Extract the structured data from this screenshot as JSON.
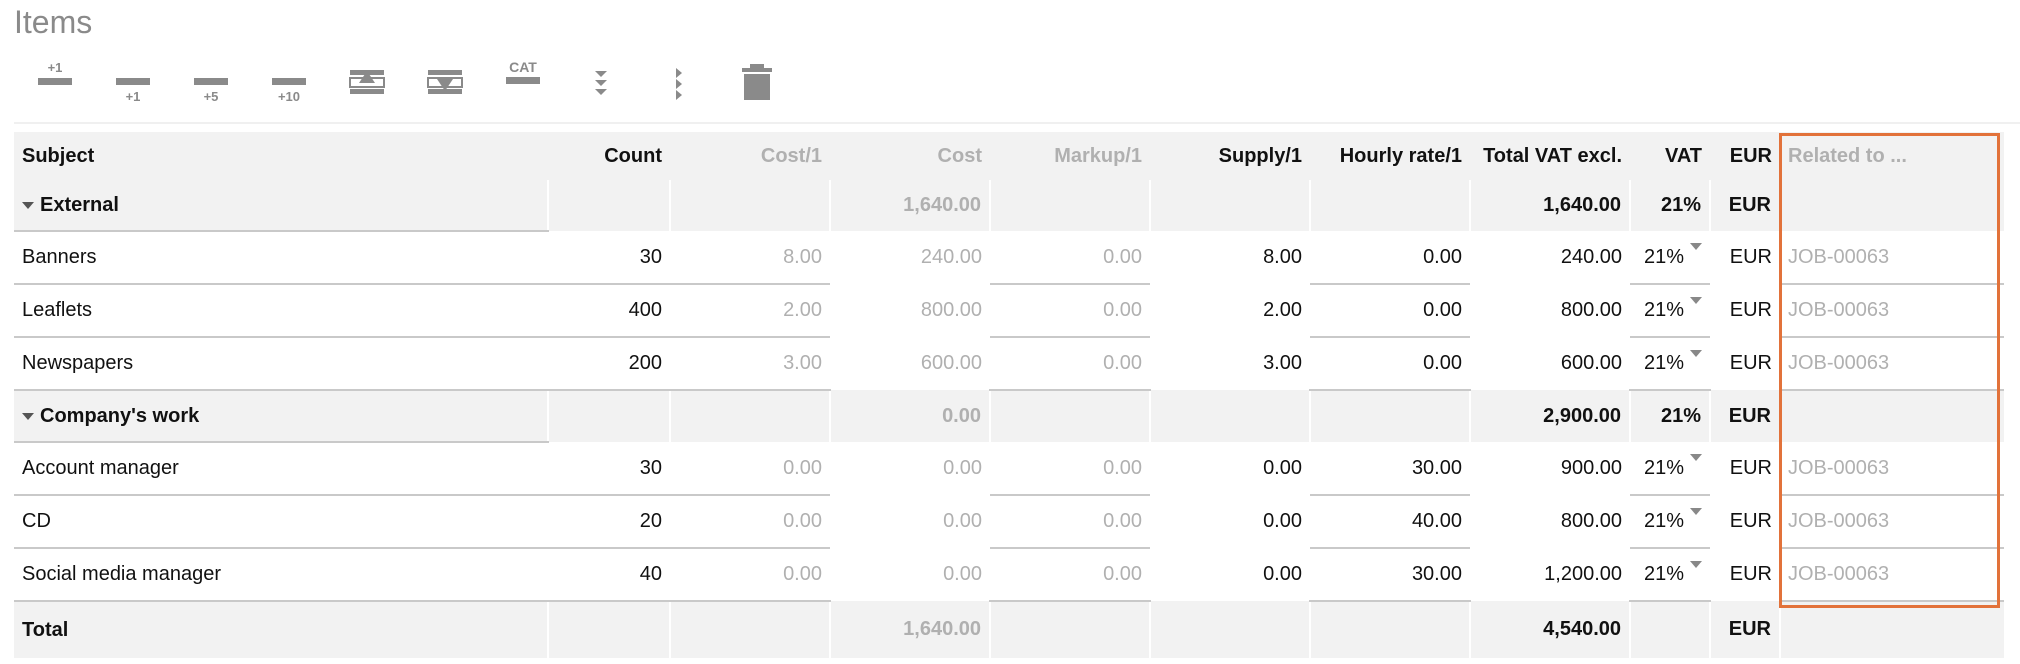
{
  "page": {
    "title": "Items"
  },
  "toolbar": {
    "add_one": "+1",
    "add_row_1": "+1",
    "add_row_5": "+5",
    "add_row_10": "+10",
    "cat": "CAT"
  },
  "table": {
    "headers": {
      "subject": "Subject",
      "count": "Count",
      "cost_per": "Cost/1",
      "cost": "Cost",
      "markup_per": "Markup/1",
      "supply_per": "Supply/1",
      "hourly_rate": "Hourly rate/1",
      "total_vat_excl": "Total VAT excl.",
      "vat": "VAT",
      "currency": "EUR",
      "related_to": "Related to ..."
    },
    "groups": [
      {
        "name": "External",
        "cost": "1,640.00",
        "total": "1,640.00",
        "vat": "21%",
        "currency": "EUR",
        "items": [
          {
            "subject": "Banners",
            "count": "30",
            "cost_per": "8.00",
            "cost": "240.00",
            "markup": "0.00",
            "supply": "8.00",
            "hourly": "0.00",
            "total": "240.00",
            "vat": "21%",
            "currency": "EUR",
            "related": "JOB-00063"
          },
          {
            "subject": "Leaflets",
            "count": "400",
            "cost_per": "2.00",
            "cost": "800.00",
            "markup": "0.00",
            "supply": "2.00",
            "hourly": "0.00",
            "total": "800.00",
            "vat": "21%",
            "currency": "EUR",
            "related": "JOB-00063"
          },
          {
            "subject": "Newspapers",
            "count": "200",
            "cost_per": "3.00",
            "cost": "600.00",
            "markup": "0.00",
            "supply": "3.00",
            "hourly": "0.00",
            "total": "600.00",
            "vat": "21%",
            "currency": "EUR",
            "related": "JOB-00063"
          }
        ]
      },
      {
        "name": "Company's work",
        "cost": "0.00",
        "total": "2,900.00",
        "vat": "21%",
        "currency": "EUR",
        "items": [
          {
            "subject": "Account manager",
            "count": "30",
            "cost_per": "0.00",
            "cost": "0.00",
            "markup": "0.00",
            "supply": "0.00",
            "hourly": "30.00",
            "total": "900.00",
            "vat": "21%",
            "currency": "EUR",
            "related": "JOB-00063"
          },
          {
            "subject": "CD",
            "count": "20",
            "cost_per": "0.00",
            "cost": "0.00",
            "markup": "0.00",
            "supply": "0.00",
            "hourly": "40.00",
            "total": "800.00",
            "vat": "21%",
            "currency": "EUR",
            "related": "JOB-00063"
          },
          {
            "subject": "Social media manager",
            "count": "40",
            "cost_per": "0.00",
            "cost": "0.00",
            "markup": "0.00",
            "supply": "0.00",
            "hourly": "30.00",
            "total": "1,200.00",
            "vat": "21%",
            "currency": "EUR",
            "related": "JOB-00063"
          }
        ]
      }
    ],
    "total": {
      "label": "Total",
      "cost": "1,640.00",
      "total": "4,540.00",
      "currency": "EUR"
    }
  },
  "colors": {
    "highlight": "#e2723a",
    "icon": "#8a8a8a",
    "muted_text": "#b0b0b0",
    "row_shade": "#f2f2f2"
  }
}
